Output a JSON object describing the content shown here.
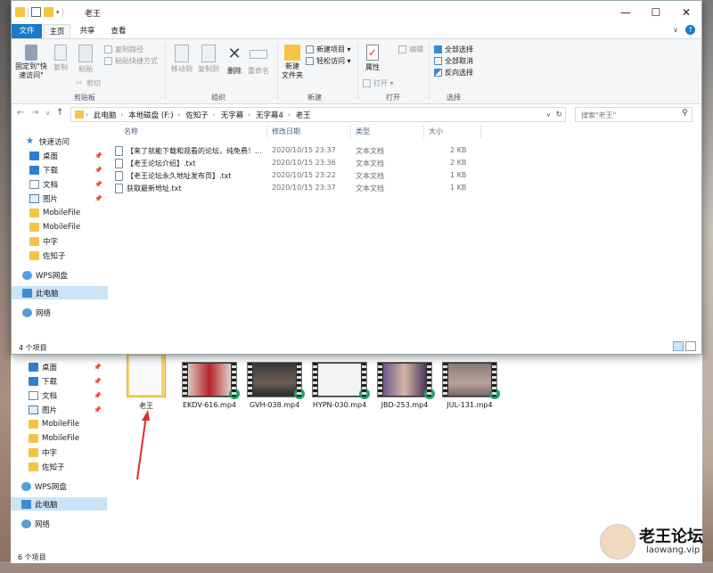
{
  "window": {
    "title": "老王",
    "controls": {
      "minimize": "—",
      "maximize": "☐",
      "close": "✕"
    }
  },
  "tabs": [
    "文件",
    "主页",
    "共享",
    "查看"
  ],
  "ribbon": {
    "clipboard": {
      "pin_label": "固定到\"快\n速访问\"",
      "copy": "复制",
      "paste": "粘贴",
      "copy_path": "复制路径",
      "paste_shortcut": "粘贴快捷方式",
      "cut": "剪切",
      "group": "剪贴板"
    },
    "organize": {
      "move_to": "移动到",
      "copy_to": "复制到",
      "delete": "删除",
      "rename": "重命名",
      "group": "组织"
    },
    "new": {
      "new_folder": "新建\n文件夹",
      "new_item": "新建项目 ▾",
      "easy_access": "轻松访问 ▾",
      "group": "新建"
    },
    "open": {
      "properties": "属性",
      "open": "打开 ▾",
      "edit": "编辑",
      "group": "打开"
    },
    "select": {
      "select_all": "全部选择",
      "select_none": "全部取消",
      "invert": "反向选择",
      "group": "选择"
    }
  },
  "address": {
    "crumbs": [
      "此电脑",
      "本地磁盘 (F:)",
      "佐知子",
      "无字幕",
      "无字幕4",
      "老王"
    ],
    "search_placeholder": "搜索\"老王\""
  },
  "nav": {
    "quick_access": "快速访问",
    "items": [
      "桌面",
      "下载",
      "文档",
      "图片",
      "MobileFile",
      "MobileFile",
      "中字",
      "佐知子"
    ],
    "wps": "WPS网盘",
    "pc": "此电脑",
    "network": "网络"
  },
  "columns": {
    "name": "名称",
    "modified": "修改日期",
    "type": "类型",
    "size": "大小"
  },
  "files": [
    {
      "name": "【来了就能下载和观看的论坛，纯免费！...",
      "modified": "2020/10/15 23:37",
      "type": "文本文档",
      "size": "2 KB"
    },
    {
      "name": "【老王论坛介绍】.txt",
      "modified": "2020/10/15 23:36",
      "type": "文本文档",
      "size": "2 KB"
    },
    {
      "name": "【老王论坛永久地址发布页】.txt",
      "modified": "2020/10/15 23:22",
      "type": "文本文档",
      "size": "1 KB"
    },
    {
      "name": "获取最新地址.txt",
      "modified": "2020/10/15 23:37",
      "type": "文本文档",
      "size": "1 KB"
    }
  ],
  "status": "4 个项目",
  "back_window": {
    "folder_label": "老王",
    "videos": [
      "EKDV-616.mp4",
      "GVH-038.mp4",
      "HYPN-030.mp4",
      "JBD-253.mp4",
      "JUL-131.mp4"
    ],
    "status": "6 个项目"
  },
  "watermark": {
    "title": "老王论坛",
    "url": "laowang.vip"
  },
  "colors": {
    "accent": "#1979ca",
    "selection": "#cce4f7",
    "folder": "#f5c542"
  }
}
